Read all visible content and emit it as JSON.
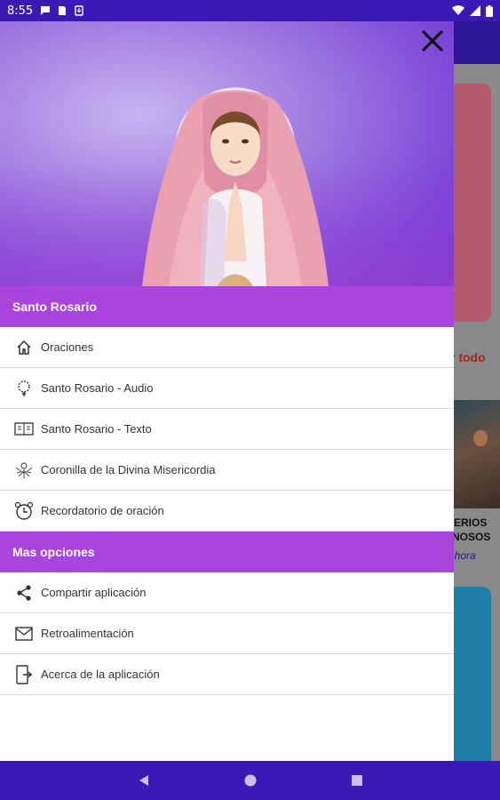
{
  "status_bar": {
    "time": "8:55",
    "icons": [
      "chat-icon",
      "sim-icon",
      "download-icon"
    ],
    "right_icons": [
      "wifi-icon",
      "signal-icon",
      "battery-icon"
    ]
  },
  "drawer": {
    "header_image": "virgin-mary-illustration",
    "close_icon": "close-icon",
    "sections": [
      {
        "title": "Santo Rosario",
        "items": [
          {
            "label": "Oraciones",
            "icon": "home-icon"
          },
          {
            "label": "Santo Rosario - Audio",
            "icon": "rosary-icon"
          },
          {
            "label": "Santo Rosario - Texto",
            "icon": "book-icon"
          },
          {
            "label": "Coronilla de la Divina Misericordia",
            "icon": "divine-mercy-icon"
          },
          {
            "label": "Recordatorio de oración",
            "icon": "alarm-clock-icon"
          }
        ]
      },
      {
        "title": "Mas opciones",
        "items": [
          {
            "label": "Compartir aplicación",
            "icon": "share-icon"
          },
          {
            "label": "Retroalimentación",
            "icon": "mail-icon"
          },
          {
            "label": "Acerca de la aplicación",
            "icon": "about-icon"
          }
        ]
      }
    ]
  },
  "background_app": {
    "see_all": "r todo",
    "thumb_caption_1": "ERIOS",
    "thumb_caption_2": "NOSOS",
    "thumb_link": "ahora"
  },
  "nav_bar": {
    "buttons": [
      "back-icon",
      "home-circle-icon",
      "recents-icon"
    ]
  },
  "colors": {
    "system_bar": "#3a1ab5",
    "section_header": "#a845dc",
    "divider": "#d8d8d8"
  }
}
